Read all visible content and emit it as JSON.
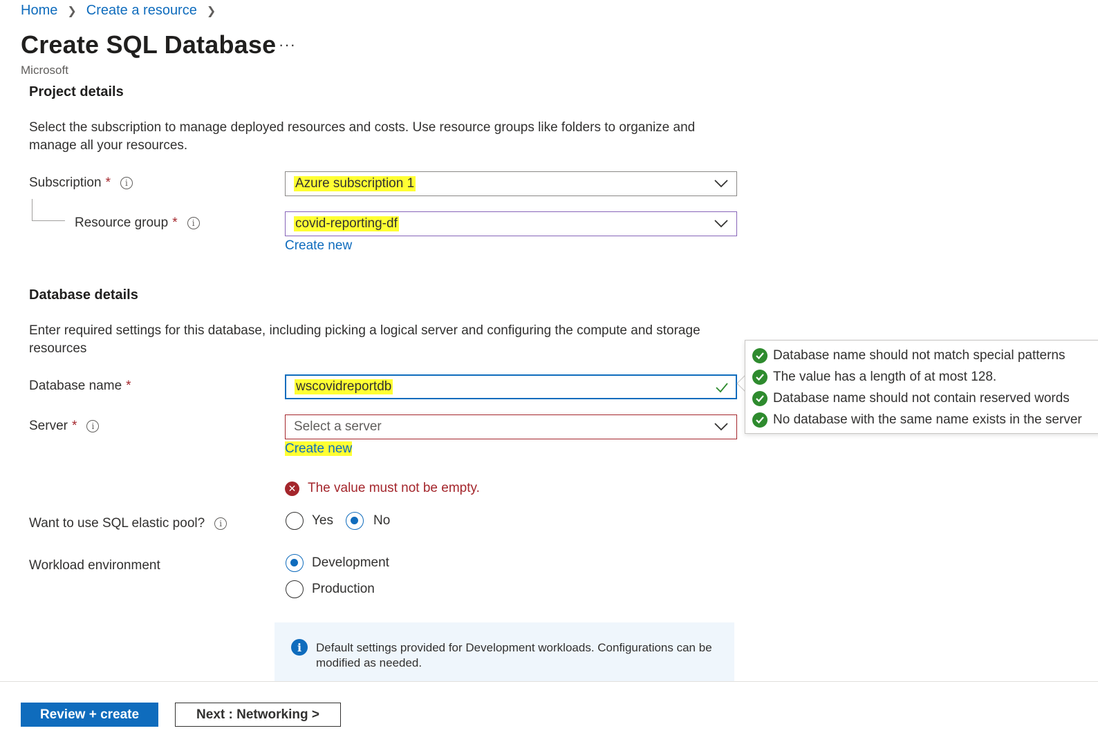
{
  "breadcrumb": {
    "home": "Home",
    "create_resource": "Create a resource"
  },
  "page": {
    "title": "Create SQL Database",
    "more": "···",
    "publisher": "Microsoft"
  },
  "project": {
    "heading": "Project details",
    "description": "Select the subscription to manage deployed resources and costs. Use resource groups like folders to organize and manage all your resources.",
    "subscription_label": "Subscription",
    "subscription_value": "Azure subscription 1",
    "resource_group_label": "Resource group",
    "resource_group_value": "covid-reporting-df",
    "create_new": "Create new"
  },
  "database": {
    "heading": "Database details",
    "description": "Enter required settings for this database, including picking a logical server and configuring the compute and storage resources",
    "name_label": "Database name",
    "name_value": "wscovidreportdb",
    "server_label": "Server",
    "server_placeholder": "Select a server",
    "create_new": "Create new",
    "server_error": "The value must not be empty.",
    "elastic_label": "Want to use SQL elastic pool?",
    "elastic_options": [
      "Yes",
      "No"
    ],
    "elastic_selected": "No",
    "workload_label": "Workload environment",
    "workload_options": [
      "Development",
      "Production"
    ],
    "workload_selected": "Development",
    "info_text": "Default settings provided for Development workloads. Configurations can be modified as needed."
  },
  "validation": [
    "Database name should not match special patterns",
    "The value has a length of at most 128.",
    "Database name should not contain reserved words",
    "No database with the same name exists in the server"
  ],
  "footer": {
    "review_create": "Review + create",
    "next": "Next : Networking >"
  },
  "required_mark": "*",
  "colors": {
    "accent": "#0f6cbd",
    "highlight": "#ffff33",
    "error": "#a4262c",
    "success": "#2e8b2e"
  }
}
